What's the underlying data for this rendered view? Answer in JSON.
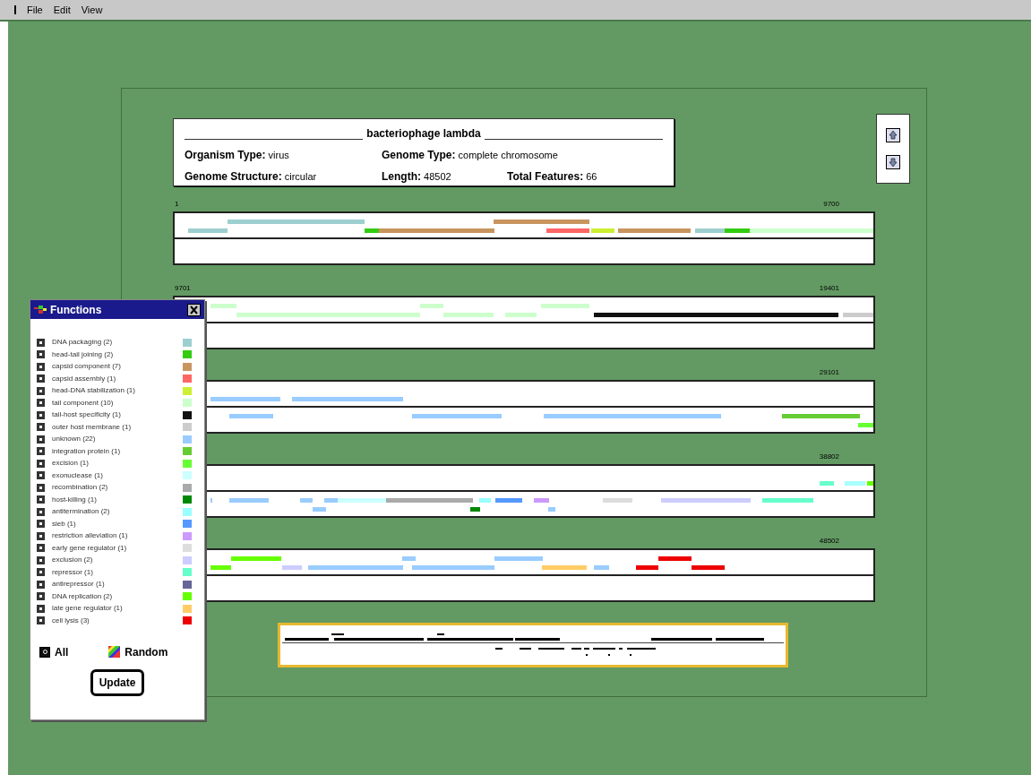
{
  "menu_bar": {
    "items": [
      "File",
      "Edit",
      "View"
    ]
  },
  "header": {
    "title": "bacteriophage lambda",
    "fields": [
      {
        "label": "Organism Type:",
        "value": "virus"
      },
      {
        "label": "Genome Type:",
        "value": "complete chromosome"
      },
      {
        "label": "Genome Structure:",
        "value": "circular"
      },
      {
        "label": "Length:",
        "value": "48502"
      },
      {
        "label": "Total Features:",
        "value": "66"
      }
    ]
  },
  "segments": [
    {
      "start": "1",
      "end": "9700"
    },
    {
      "start": "9701",
      "end": "19401"
    },
    {
      "end": "29101"
    },
    {
      "end": "38802"
    },
    {
      "end": "48502"
    }
  ],
  "functions": {
    "title": "Functions",
    "items": [
      {
        "label": "DNA packaging (2)",
        "checked": true,
        "color": "#9ecfd0"
      },
      {
        "label": "head-tail joining (2)",
        "checked": true,
        "color": "#33cc11"
      },
      {
        "label": "capsid component (7)",
        "checked": true,
        "color": "#c8955f"
      },
      {
        "label": "capsid assembly (1)",
        "checked": true,
        "color": "#ff6666"
      },
      {
        "label": "head-DNA stabilization (1)",
        "checked": true,
        "color": "#ccee33"
      },
      {
        "label": "tail component (10)",
        "checked": true,
        "color": "#ccffcc"
      },
      {
        "label": "tail-host specificity (1)",
        "checked": true,
        "color": "#111111"
      },
      {
        "label": "outer host membrane (1)",
        "checked": true,
        "color": "#cccccc"
      },
      {
        "label": "unknown (22)",
        "checked": true,
        "color": "#99ccff"
      },
      {
        "label": "integration protein (1)",
        "checked": true,
        "color": "#66cc33"
      },
      {
        "label": "excision (1)",
        "checked": true,
        "color": "#66ff33"
      },
      {
        "label": "exonuclease (1)",
        "checked": true,
        "color": "#ccffff"
      },
      {
        "label": "recombination (2)",
        "checked": true,
        "color": "#aaaaaa"
      },
      {
        "label": "host-killing (1)",
        "checked": true,
        "color": "#008800"
      },
      {
        "label": "antitermination (2)",
        "checked": true,
        "color": "#99ffff"
      },
      {
        "label": "sieb (1)",
        "checked": true,
        "color": "#5599ff"
      },
      {
        "label": "restriction alleviation (1)",
        "checked": true,
        "color": "#cc99ff"
      },
      {
        "label": "early gene regulator (1)",
        "checked": true,
        "color": "#dddddd"
      },
      {
        "label": "exclusion (2)",
        "checked": true,
        "color": "#ccccff"
      },
      {
        "label": "repressor (1)",
        "checked": true,
        "color": "#66ffcc"
      },
      {
        "label": "antirepressor (1)",
        "checked": true,
        "color": "#666699"
      },
      {
        "label": "DNA replication (2)",
        "checked": true,
        "color": "#66ff00"
      },
      {
        "label": "late gene regulator (1)",
        "checked": true,
        "color": "#ffcc66"
      },
      {
        "label": "cell lysis (3)",
        "checked": true,
        "color": "#ee0000"
      }
    ],
    "all": {
      "label": "All",
      "checked": true
    },
    "random": {
      "label": "Random"
    },
    "update_button": "Update"
  }
}
